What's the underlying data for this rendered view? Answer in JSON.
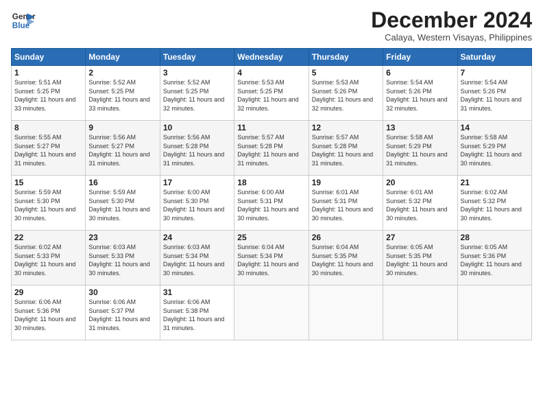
{
  "header": {
    "logo_line1": "General",
    "logo_line2": "Blue",
    "month_title": "December 2024",
    "subtitle": "Calaya, Western Visayas, Philippines"
  },
  "weekdays": [
    "Sunday",
    "Monday",
    "Tuesday",
    "Wednesday",
    "Thursday",
    "Friday",
    "Saturday"
  ],
  "weeks": [
    [
      {
        "day": 1,
        "sunrise": "5:51 AM",
        "sunset": "5:25 PM",
        "daylight": "11 hours and 33 minutes."
      },
      {
        "day": 2,
        "sunrise": "5:52 AM",
        "sunset": "5:25 PM",
        "daylight": "11 hours and 33 minutes."
      },
      {
        "day": 3,
        "sunrise": "5:52 AM",
        "sunset": "5:25 PM",
        "daylight": "11 hours and 32 minutes."
      },
      {
        "day": 4,
        "sunrise": "5:53 AM",
        "sunset": "5:25 PM",
        "daylight": "11 hours and 32 minutes."
      },
      {
        "day": 5,
        "sunrise": "5:53 AM",
        "sunset": "5:26 PM",
        "daylight": "11 hours and 32 minutes."
      },
      {
        "day": 6,
        "sunrise": "5:54 AM",
        "sunset": "5:26 PM",
        "daylight": "11 hours and 32 minutes."
      },
      {
        "day": 7,
        "sunrise": "5:54 AM",
        "sunset": "5:26 PM",
        "daylight": "11 hours and 31 minutes."
      }
    ],
    [
      {
        "day": 8,
        "sunrise": "5:55 AM",
        "sunset": "5:27 PM",
        "daylight": "11 hours and 31 minutes."
      },
      {
        "day": 9,
        "sunrise": "5:56 AM",
        "sunset": "5:27 PM",
        "daylight": "11 hours and 31 minutes."
      },
      {
        "day": 10,
        "sunrise": "5:56 AM",
        "sunset": "5:28 PM",
        "daylight": "11 hours and 31 minutes."
      },
      {
        "day": 11,
        "sunrise": "5:57 AM",
        "sunset": "5:28 PM",
        "daylight": "11 hours and 31 minutes."
      },
      {
        "day": 12,
        "sunrise": "5:57 AM",
        "sunset": "5:28 PM",
        "daylight": "11 hours and 31 minutes."
      },
      {
        "day": 13,
        "sunrise": "5:58 AM",
        "sunset": "5:29 PM",
        "daylight": "11 hours and 31 minutes."
      },
      {
        "day": 14,
        "sunrise": "5:58 AM",
        "sunset": "5:29 PM",
        "daylight": "11 hours and 30 minutes."
      }
    ],
    [
      {
        "day": 15,
        "sunrise": "5:59 AM",
        "sunset": "5:30 PM",
        "daylight": "11 hours and 30 minutes."
      },
      {
        "day": 16,
        "sunrise": "5:59 AM",
        "sunset": "5:30 PM",
        "daylight": "11 hours and 30 minutes."
      },
      {
        "day": 17,
        "sunrise": "6:00 AM",
        "sunset": "5:30 PM",
        "daylight": "11 hours and 30 minutes."
      },
      {
        "day": 18,
        "sunrise": "6:00 AM",
        "sunset": "5:31 PM",
        "daylight": "11 hours and 30 minutes."
      },
      {
        "day": 19,
        "sunrise": "6:01 AM",
        "sunset": "5:31 PM",
        "daylight": "11 hours and 30 minutes."
      },
      {
        "day": 20,
        "sunrise": "6:01 AM",
        "sunset": "5:32 PM",
        "daylight": "11 hours and 30 minutes."
      },
      {
        "day": 21,
        "sunrise": "6:02 AM",
        "sunset": "5:32 PM",
        "daylight": "11 hours and 30 minutes."
      }
    ],
    [
      {
        "day": 22,
        "sunrise": "6:02 AM",
        "sunset": "5:33 PM",
        "daylight": "11 hours and 30 minutes."
      },
      {
        "day": 23,
        "sunrise": "6:03 AM",
        "sunset": "5:33 PM",
        "daylight": "11 hours and 30 minutes."
      },
      {
        "day": 24,
        "sunrise": "6:03 AM",
        "sunset": "5:34 PM",
        "daylight": "11 hours and 30 minutes."
      },
      {
        "day": 25,
        "sunrise": "6:04 AM",
        "sunset": "5:34 PM",
        "daylight": "11 hours and 30 minutes."
      },
      {
        "day": 26,
        "sunrise": "6:04 AM",
        "sunset": "5:35 PM",
        "daylight": "11 hours and 30 minutes."
      },
      {
        "day": 27,
        "sunrise": "6:05 AM",
        "sunset": "5:35 PM",
        "daylight": "11 hours and 30 minutes."
      },
      {
        "day": 28,
        "sunrise": "6:05 AM",
        "sunset": "5:36 PM",
        "daylight": "11 hours and 30 minutes."
      }
    ],
    [
      {
        "day": 29,
        "sunrise": "6:06 AM",
        "sunset": "5:36 PM",
        "daylight": "11 hours and 30 minutes."
      },
      {
        "day": 30,
        "sunrise": "6:06 AM",
        "sunset": "5:37 PM",
        "daylight": "11 hours and 31 minutes."
      },
      {
        "day": 31,
        "sunrise": "6:06 AM",
        "sunset": "5:38 PM",
        "daylight": "11 hours and 31 minutes."
      },
      null,
      null,
      null,
      null
    ]
  ]
}
